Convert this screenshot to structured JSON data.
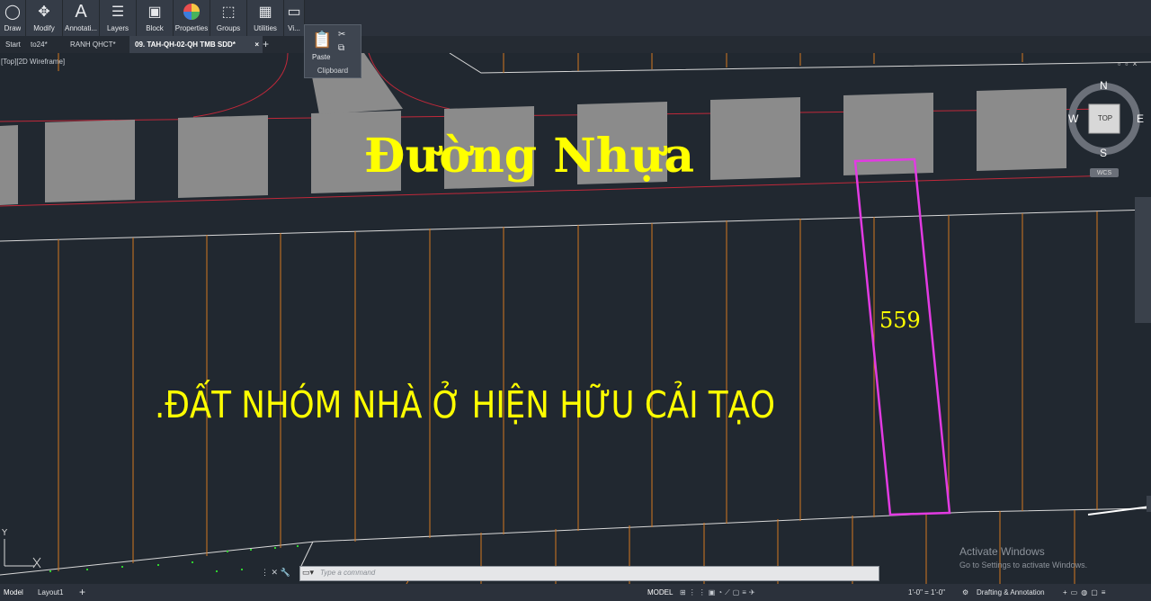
{
  "ribbon": {
    "buttons": [
      {
        "label": "Draw",
        "icon": "draw-icon"
      },
      {
        "label": "Modify",
        "icon": "move-icon"
      },
      {
        "label": "Annotati...",
        "icon": "text-a-icon"
      },
      {
        "label": "Layers",
        "icon": "layers-icon"
      },
      {
        "label": "Block",
        "icon": "block-icon"
      },
      {
        "label": "Properties",
        "icon": "color-wheel-icon"
      },
      {
        "label": "Groups",
        "icon": "groups-icon"
      },
      {
        "label": "Utilities",
        "icon": "calculator-icon"
      },
      {
        "label": "Vi...",
        "icon": "view-icon"
      }
    ]
  },
  "clipboard": {
    "paste_label": "Paste",
    "panel_label": "Clipboard"
  },
  "tabs": [
    {
      "label": "Start"
    },
    {
      "label": "to24*"
    },
    {
      "label": "RANH QHCT*"
    },
    {
      "label": "09. TAH-QH-02-QH TMB SDD*",
      "active": true,
      "close": "×"
    }
  ],
  "new_tab_symbol": "+",
  "viewport_label": "[Top][2D Wireframe]",
  "drawing": {
    "road_label": "Đường Nhựa",
    "parcel_number": "559",
    "zone_label": ".ĐẤT NHÓM NHÀ Ở HIỆN HỮU CẢI TẠO",
    "road_label_color": "#ffff00",
    "highlight_color": "#e23be2"
  },
  "viewcube": {
    "north": "N",
    "south": "S",
    "east": "E",
    "west": "W",
    "face": "TOP",
    "ucs": "WCS"
  },
  "axis": {
    "y": "Y"
  },
  "command_line": {
    "placeholder": "Type a command"
  },
  "layout_tabs": [
    {
      "label": "Model"
    },
    {
      "label": "Layout1"
    }
  ],
  "status": {
    "model": "MODEL",
    "scale": "1'-0\" = 1'-0\"",
    "workspace": "Drafting & Annotation"
  },
  "windows_activation": {
    "title": "Activate Windows",
    "subtitle": "Go to Settings to activate Windows."
  }
}
